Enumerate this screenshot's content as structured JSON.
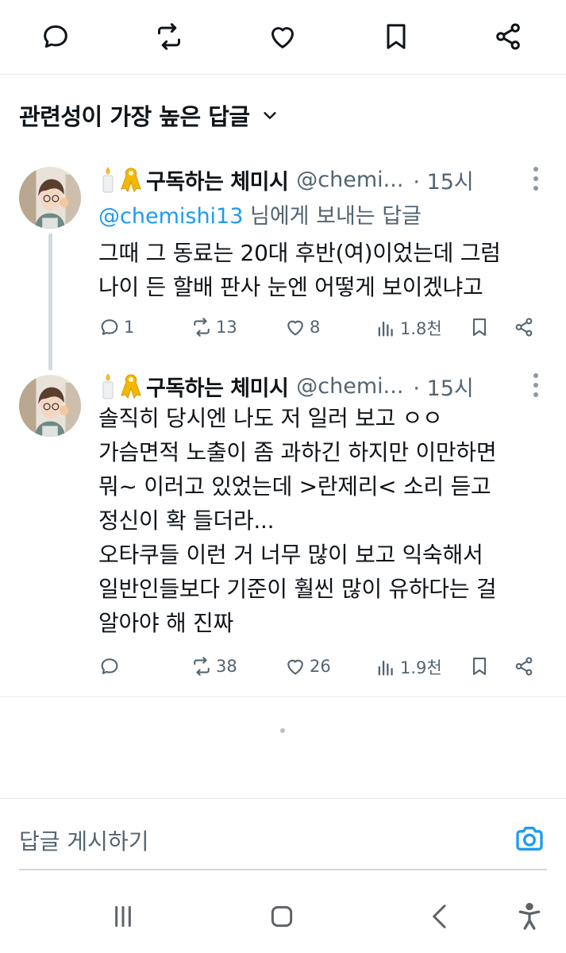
{
  "sort": {
    "label": "관련성이 가장 높은 답글"
  },
  "tweets": [
    {
      "emoji": [
        "candle-icon",
        "yellow-ribbon-icon"
      ],
      "name": "구독하는 체미시",
      "handle": "@chemi...",
      "time": "· 15시",
      "reply_to_mention": "@chemishi13",
      "reply_to_suffix": " 님에게 보내는 답글",
      "text": "그때 그 동료는 20대 후반(여)이었는데 그럼\n나이 든 할배 판사 눈엔 어떻게 보이겠냐고",
      "replies": "1",
      "retweets": "13",
      "likes": "8",
      "views": "1.8천"
    },
    {
      "emoji": [
        "candle-icon",
        "yellow-ribbon-icon"
      ],
      "name": "구독하는 체미시",
      "handle": "@chemi...",
      "time": "· 15시",
      "text": "솔직히 당시엔 나도 저 일러 보고 ㅇㅇ\n가슴면적 노출이 좀 과하긴 하지만 이만하면\n뭐~ 이러고 있었는데 >란제리< 소리 듣고\n정신이 확 들더라...\n오타쿠들 이런 거 너무 많이 보고 익숙해서\n일반인들보다 기준이 훨씬 많이 유하다는 걸\n알아야 해 진짜",
      "replies": "",
      "retweets": "38",
      "likes": "26",
      "views": "1.9천"
    }
  ],
  "compose": {
    "placeholder": "답글 게시하기"
  },
  "colors": {
    "accent": "#1d9bf0",
    "muted": "#536471",
    "text": "#0f1419",
    "ribbon": "#f5b800"
  }
}
